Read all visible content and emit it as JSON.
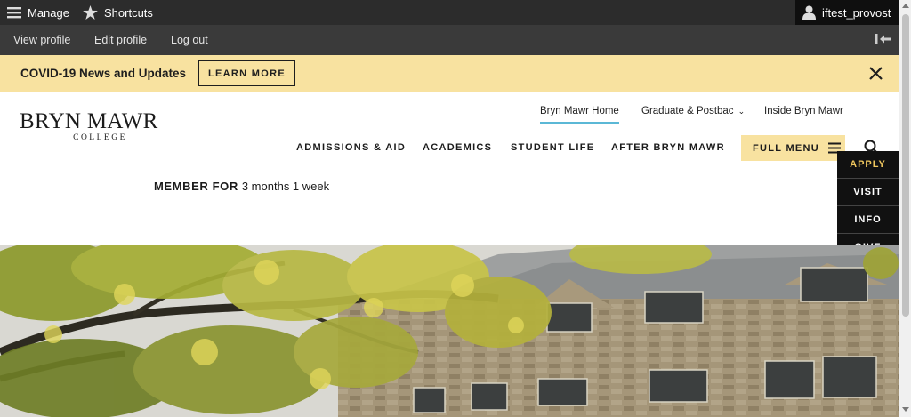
{
  "toolbar": {
    "manage_label": "Manage",
    "shortcuts_label": "Shortcuts",
    "user_label": "iftest_provost"
  },
  "subbar": {
    "view_profile": "View profile",
    "edit_profile": "Edit profile",
    "log_out": "Log out"
  },
  "alert": {
    "text": "COVID-19 News and Updates",
    "button": "LEARN MORE"
  },
  "logo": {
    "main": "BRYN MAWR",
    "sub": "COLLEGE"
  },
  "utility_nav": {
    "home": "Bryn Mawr Home",
    "graduate": "Graduate & Postbac",
    "inside": "Inside Bryn Mawr"
  },
  "main_nav": {
    "admissions": "ADMISSIONS & AID",
    "academics": "ACADEMICS",
    "student_life": "STUDENT LIFE",
    "after": "AFTER BRYN MAWR",
    "full_menu": "FULL MENU"
  },
  "quick_links": {
    "apply": "APPLY",
    "visit": "VISIT",
    "info": "INFO",
    "give": "GIVE"
  },
  "member": {
    "label": "MEMBER FOR",
    "value": "3 months 1 week"
  },
  "colors": {
    "toolbar_bg": "#2c2c2c",
    "alert_bg": "#f8e2a0",
    "accent_underline": "#5bb8d6",
    "apply_gold": "#f0c75e"
  }
}
